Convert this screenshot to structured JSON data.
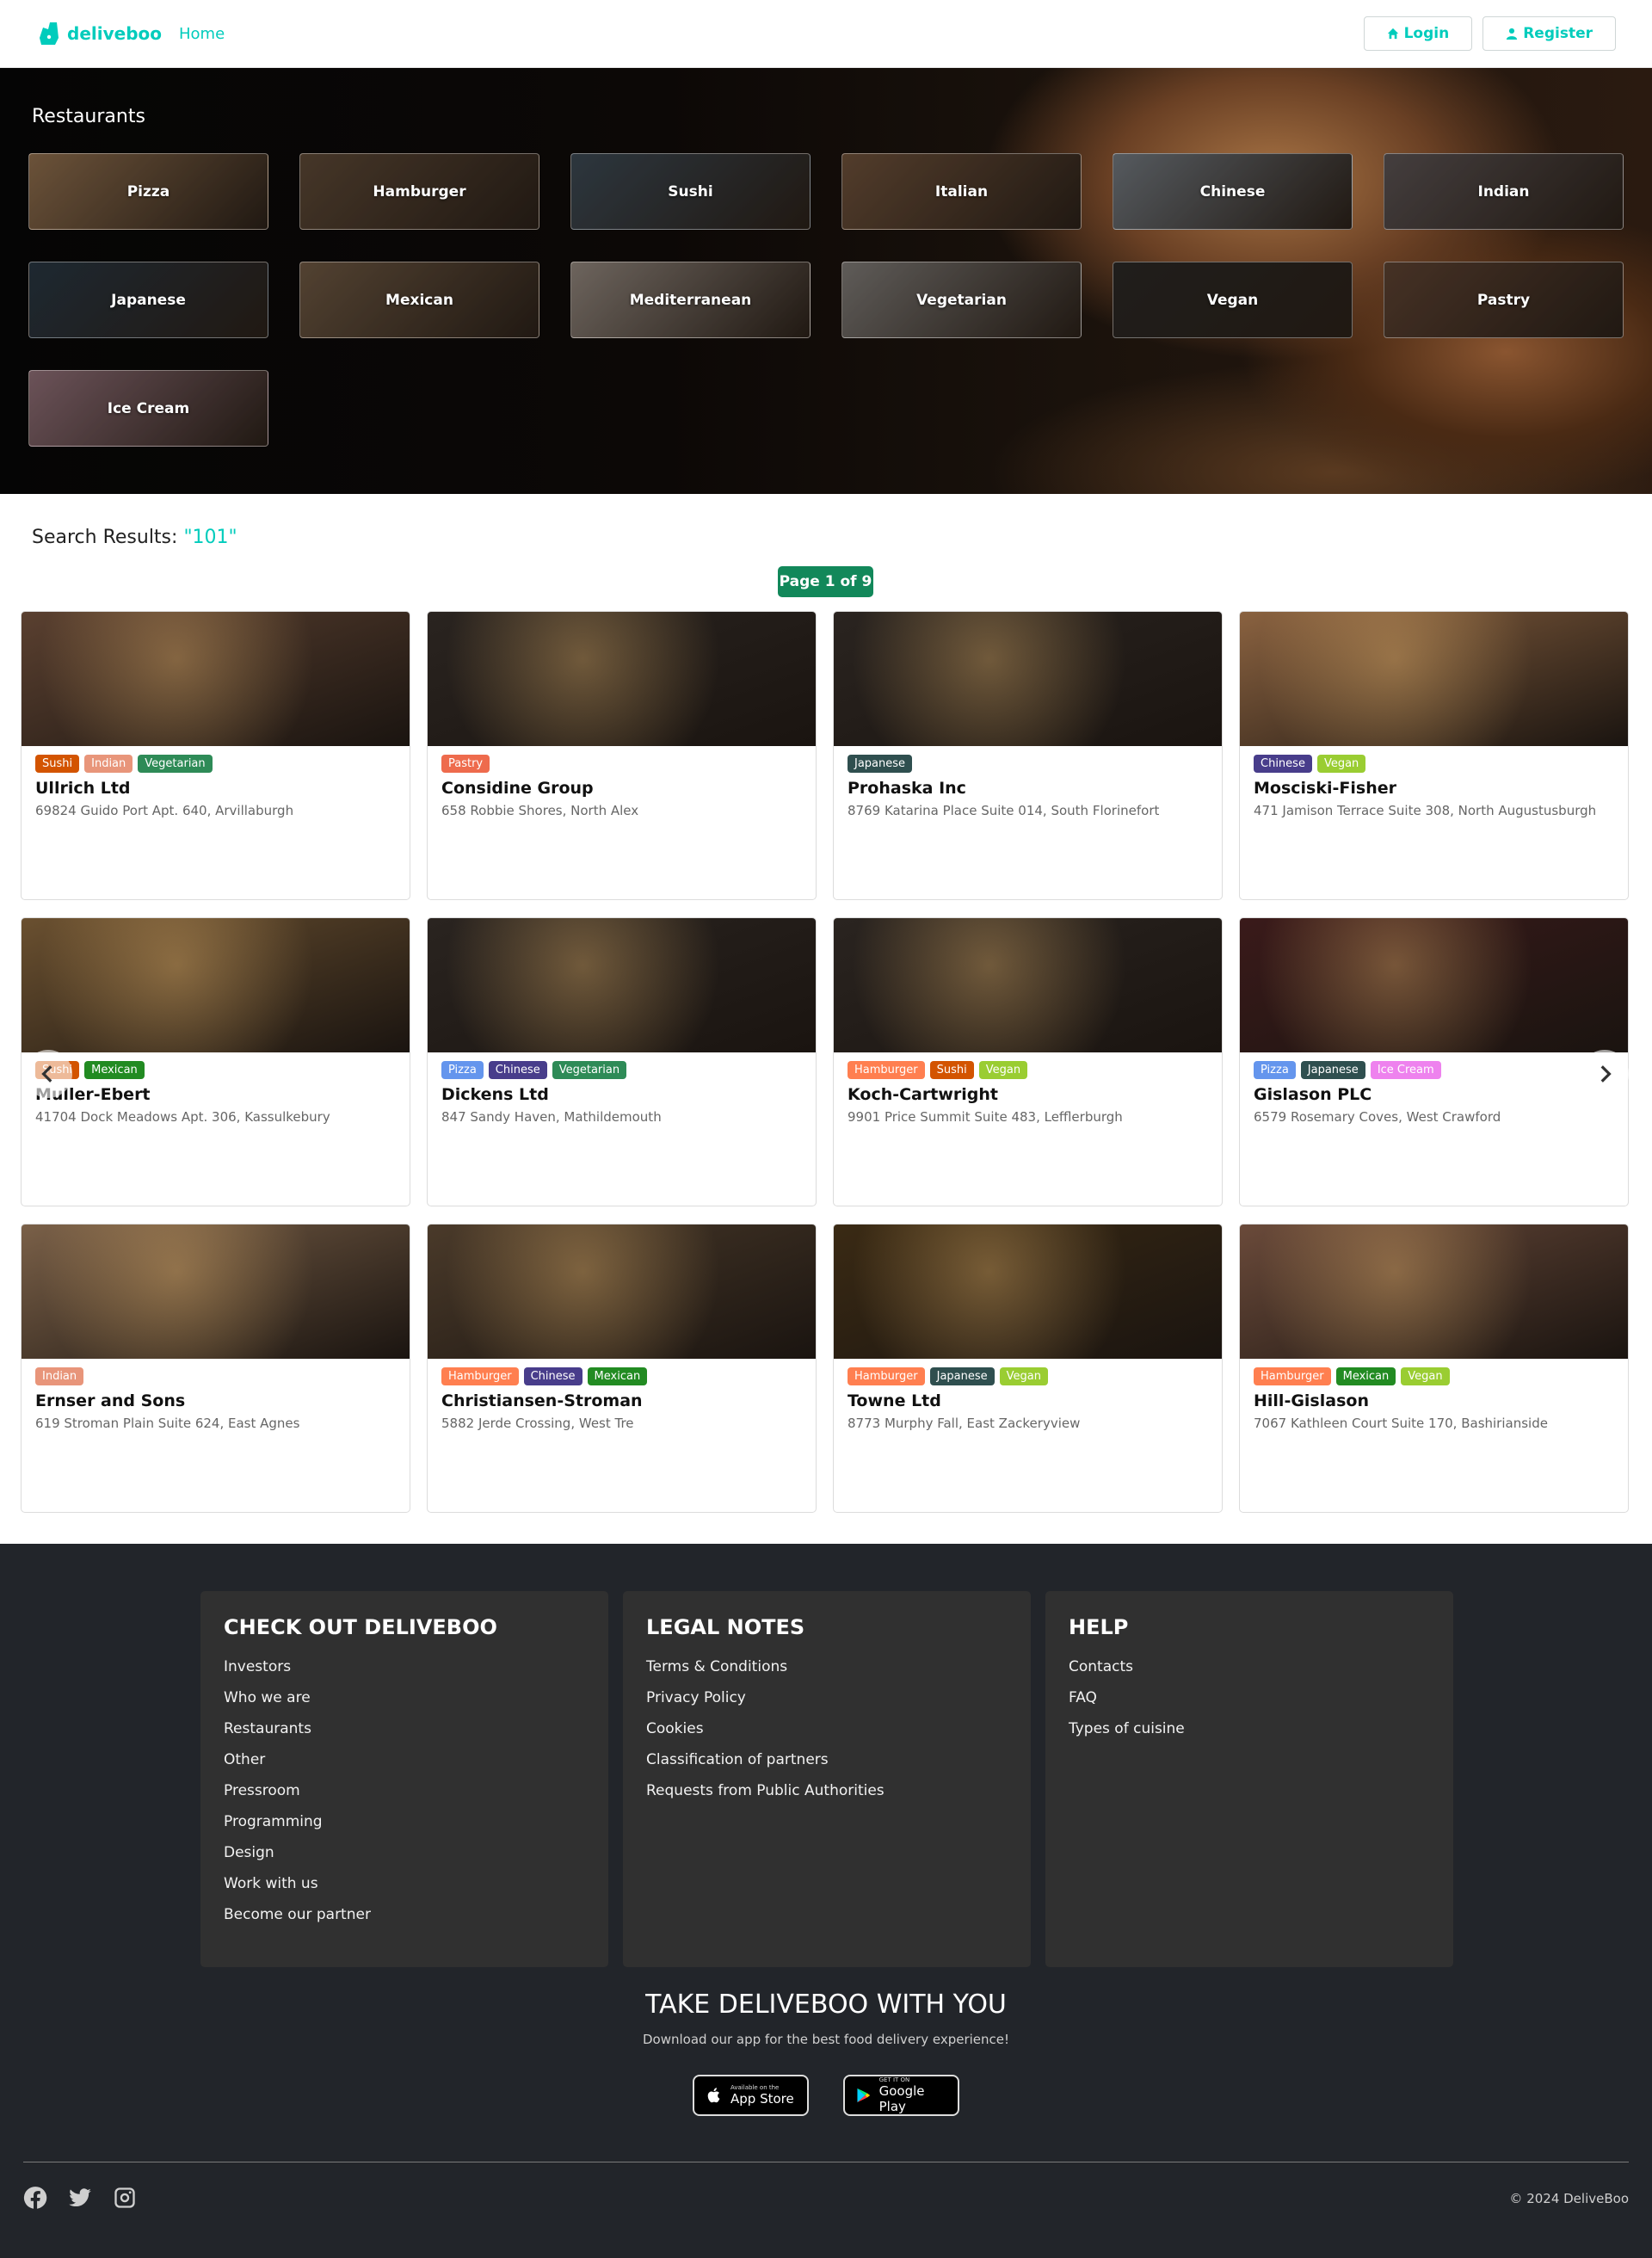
{
  "nav": {
    "brand": "deliveboo",
    "home": "Home",
    "login": "Login",
    "register": "Register"
  },
  "hero": {
    "title": "Restaurants",
    "categories": [
      {
        "label": "Pizza",
        "color": "#8a6a4a"
      },
      {
        "label": "Hamburger",
        "color": "#5a4634"
      },
      {
        "label": "Sushi",
        "color": "#3a4650"
      },
      {
        "label": "Italian",
        "color": "#6a4e38"
      },
      {
        "label": "Chinese",
        "color": "#6e747a"
      },
      {
        "label": "Indian",
        "color": "#585050"
      },
      {
        "label": "Japanese",
        "color": "#27343f"
      },
      {
        "label": "Mexican",
        "color": "#6a5540"
      },
      {
        "label": "Mediterranean",
        "color": "#8c8178"
      },
      {
        "label": "Vegetarian",
        "color": "#7a7672"
      },
      {
        "label": "Vegan",
        "color": "#2a2724"
      },
      {
        "label": "Pastry",
        "color": "#5a4030"
      },
      {
        "label": "Ice Cream",
        "color": "#8a6a72"
      }
    ]
  },
  "search": {
    "label": "Search Results:",
    "query": "\"101\"",
    "page": "Page 1 of 9"
  },
  "restaurants": [
    {
      "name": "Ullrich Ltd",
      "address": "69824 Guido Port Apt. 640, Arvillaburgh",
      "img": "#5a4030",
      "tags": [
        {
          "label": "Sushi",
          "color": "#d35400"
        },
        {
          "label": "Indian",
          "color": "#e8957a"
        },
        {
          "label": "Vegetarian",
          "color": "#2e8b57"
        }
      ]
    },
    {
      "name": "Considine Group",
      "address": "658 Robbie Shores, North Alex",
      "img": "#2a2420",
      "tags": [
        {
          "label": "Pastry",
          "color": "#ee6b4d"
        }
      ]
    },
    {
      "name": "Prohaska Inc",
      "address": "8769 Katarina Place Suite 014, South Florinefort",
      "img": "#2a2420",
      "tags": [
        {
          "label": "Japanese",
          "color": "#2f4f4f"
        }
      ]
    },
    {
      "name": "Mosciski-Fisher",
      "address": "471 Jamison Terrace Suite 308, North Augustusburgh",
      "img": "#8a6240",
      "tags": [
        {
          "label": "Chinese",
          "color": "#483d8b"
        },
        {
          "label": "Vegan",
          "color": "#9acd32"
        }
      ]
    },
    {
      "name": "Muller-Ebert",
      "address": "41704 Dock Meadows Apt. 306, Kassulkebury",
      "img": "#6a5030",
      "tags": [
        {
          "label": "Sushi",
          "color": "#d35400"
        },
        {
          "label": "Mexican",
          "color": "#228b22"
        }
      ]
    },
    {
      "name": "Dickens Ltd",
      "address": "847 Sandy Haven, Mathildemouth",
      "img": "#2a2420",
      "tags": [
        {
          "label": "Pizza",
          "color": "#6495ed"
        },
        {
          "label": "Chinese",
          "color": "#483d8b"
        },
        {
          "label": "Vegetarian",
          "color": "#2e8b57"
        }
      ]
    },
    {
      "name": "Koch-Cartwright",
      "address": "9901 Price Summit Suite 483, Lefflerburgh",
      "img": "#2a2420",
      "tags": [
        {
          "label": "Hamburger",
          "color": "#ff7f50"
        },
        {
          "label": "Sushi",
          "color": "#d35400"
        },
        {
          "label": "Vegan",
          "color": "#9acd32"
        }
      ]
    },
    {
      "name": "Gislason PLC",
      "address": "6579 Rosemary Coves, West Crawford",
      "img": "#3a1a1a",
      "tags": [
        {
          "label": "Pizza",
          "color": "#6495ed"
        },
        {
          "label": "Japanese",
          "color": "#2f4f4f"
        },
        {
          "label": "Ice Cream",
          "color": "#ee82ee"
        }
      ]
    },
    {
      "name": "Ernser and Sons",
      "address": "619 Stroman Plain Suite 624, East Agnes",
      "img": "#7a6048",
      "tags": [
        {
          "label": "Indian",
          "color": "#e8957a"
        }
      ]
    },
    {
      "name": "Christiansen-Stroman",
      "address": "5882 Jerde Crossing, West Tre",
      "img": "#4a3a2a",
      "tags": [
        {
          "label": "Hamburger",
          "color": "#ff7f50"
        },
        {
          "label": "Chinese",
          "color": "#483d8b"
        },
        {
          "label": "Mexican",
          "color": "#228b22"
        }
      ]
    },
    {
      "name": "Towne Ltd",
      "address": "8773 Murphy Fall, East Zackeryview",
      "img": "#3a2a14",
      "tags": [
        {
          "label": "Hamburger",
          "color": "#ff7f50"
        },
        {
          "label": "Japanese",
          "color": "#2f4f4f"
        },
        {
          "label": "Vegan",
          "color": "#9acd32"
        }
      ]
    },
    {
      "name": "Hill-Gislason",
      "address": "7067 Kathleen Court Suite 170, Bashirianside",
      "img": "#6a4a3a",
      "tags": [
        {
          "label": "Hamburger",
          "color": "#ff7f50"
        },
        {
          "label": "Mexican",
          "color": "#228b22"
        },
        {
          "label": "Vegan",
          "color": "#9acd32"
        }
      ]
    }
  ],
  "footer": {
    "columns": [
      {
        "title": "CHECK OUT DELIVEBOO",
        "links": [
          "Investors",
          "Who we are",
          "Restaurants",
          "Other",
          "Pressroom",
          "Programming",
          "Design",
          "Work with us",
          "Become our partner"
        ]
      },
      {
        "title": "LEGAL NOTES",
        "links": [
          "Terms & Conditions",
          "Privacy Policy",
          "Cookies",
          "Classification of partners",
          "Requests from Public Authorities"
        ]
      },
      {
        "title": "HELP",
        "links": [
          "Contacts",
          "FAQ",
          "Types of cuisine"
        ]
      }
    ],
    "app_title": "TAKE DELIVEBOO WITH YOU",
    "app_sub": "Download our app for the best food delivery experience!",
    "appstore_small": "Available on the",
    "appstore_big": "App Store",
    "googleplay_small": "GET IT ON",
    "googleplay_big": "Google Play",
    "copyright": "© 2024 DeliveBoo"
  }
}
